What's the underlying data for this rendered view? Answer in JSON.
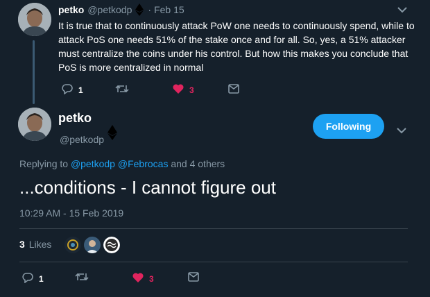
{
  "first_tweet": {
    "name": "petko",
    "handle": "@petkodp",
    "sep": "·",
    "date": "Feb 15",
    "text": "It is true that to continuously attack PoW one needs to continuously spend, while to attack PoS one needs 51% of the stake once and for all. So, yes, a 51% attacker must centralize the coins under his control. But how this makes you conclude that PoS is more centralized in normal",
    "replies": "1",
    "likes": "3"
  },
  "main_tweet": {
    "name": "petko",
    "handle": "@petkodp",
    "follow_label": "Following",
    "replying_prefix": "Replying to",
    "replying_user1": "@petkodp",
    "replying_user2": "@Febrocas",
    "replying_suffix": "and 4 others",
    "text": "...conditions - I cannot figure out",
    "timestamp": "10:29 AM - 15 Feb 2019",
    "likes_count": "3",
    "likes_label": "Likes",
    "replies": "1",
    "likes": "3"
  },
  "icons": [
    "ethereum-diamond-icon",
    "chevron-down-icon",
    "reply-icon",
    "retweet-icon",
    "heart-icon",
    "message-icon"
  ],
  "colors": {
    "background": "#15202b",
    "accent": "#1da1f2",
    "like": "#e0245e",
    "muted": "#8899a6"
  }
}
